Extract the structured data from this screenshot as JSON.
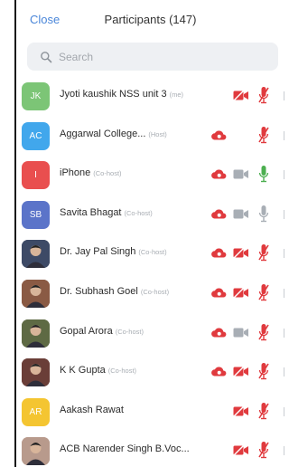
{
  "header": {
    "close_label": "Close",
    "title": "Participants (147)"
  },
  "search": {
    "placeholder": "Search"
  },
  "colors": {
    "accent": "#4a86d9",
    "danger": "#e03a3e",
    "ok": "#4caf50",
    "muted": "#a8aeb5"
  },
  "participants": [
    {
      "name": "Jyoti kaushik NSS unit 3",
      "tag": "(me)",
      "avatar_text": "JK",
      "avatar_color": "#7cc576",
      "cloud": false,
      "video": "off",
      "mic": "muted"
    },
    {
      "name": "Aggarwal College...",
      "tag": "(Host)",
      "avatar_text": "AC",
      "avatar_color": "#41a7ec",
      "cloud": true,
      "video": "none",
      "mic": "muted"
    },
    {
      "name": "iPhone",
      "tag": "(Co-host)",
      "avatar_text": "I",
      "avatar_color": "#e94f4f",
      "cloud": true,
      "video": "grey",
      "mic": "active"
    },
    {
      "name": "Savita Bhagat",
      "tag": "(Co-host)",
      "avatar_text": "SB",
      "avatar_color": "#5b74c9",
      "cloud": true,
      "video": "grey",
      "mic": "grey"
    },
    {
      "name": "Dr. Jay Pal Singh",
      "tag": "(Co-host)",
      "avatar_text": "",
      "avatar_color": "#3d4a66",
      "cloud": true,
      "video": "off",
      "mic": "muted"
    },
    {
      "name": "Dr. Subhash Goel",
      "tag": "(Co-host)",
      "avatar_text": "",
      "avatar_color": "#8a5a44",
      "cloud": true,
      "video": "off",
      "mic": "muted"
    },
    {
      "name": "Gopal Arora",
      "tag": "(Co-host)",
      "avatar_text": "",
      "avatar_color": "#5e6a44",
      "cloud": true,
      "video": "grey",
      "mic": "muted"
    },
    {
      "name": "K K Gupta",
      "tag": "(Co-host)",
      "avatar_text": "",
      "avatar_color": "#6a3e38",
      "cloud": true,
      "video": "off",
      "mic": "muted"
    },
    {
      "name": "Aakash Rawat",
      "tag": "",
      "avatar_text": "AR",
      "avatar_color": "#f4c531",
      "cloud": false,
      "video": "off",
      "mic": "muted"
    },
    {
      "name": "ACB Narender Singh B.Voc...",
      "tag": "",
      "avatar_text": "",
      "avatar_color": "#b89a8c",
      "cloud": false,
      "video": "off",
      "mic": "muted"
    }
  ],
  "icons": {
    "search": "search-icon",
    "cloud": "cloud-record-icon",
    "video_off": "video-off-icon",
    "video": "video-icon",
    "mic_muted": "mic-muted-icon",
    "mic": "mic-icon"
  }
}
